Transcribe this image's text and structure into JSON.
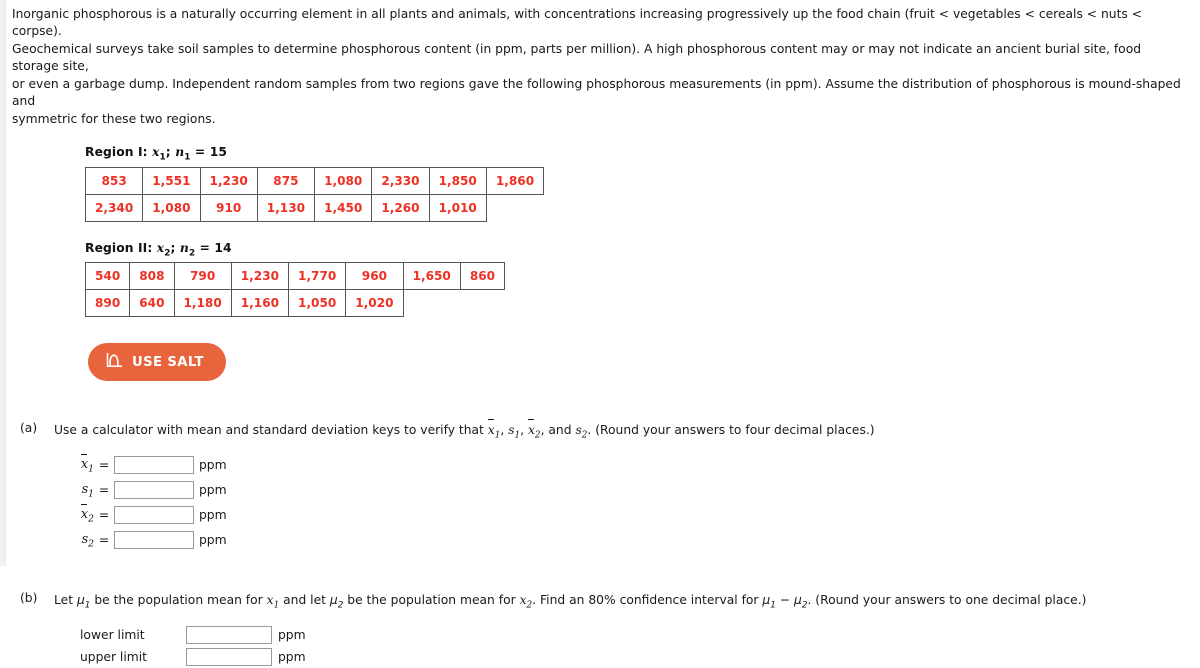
{
  "intro": {
    "line1": "Inorganic phosphorous is a naturally occurring element in all plants and animals, with concentrations increasing progressively up the food chain (fruit < vegetables < cereals < nuts < corpse).",
    "line2": "Geochemical surveys take soil samples to determine phosphorous content (in ppm, parts per million). A high phosphorous content may or may not indicate an ancient burial site, food storage site,",
    "line3": "or even a garbage dump. Independent random samples from two regions gave the following phosphorous measurements (in ppm). Assume the distribution of phosphorous is mound-shaped and",
    "line4": "symmetric for these two regions."
  },
  "regions": [
    {
      "title_prefix": "Region I:",
      "variable": "x",
      "var_sub": "1",
      "n_sub": "1",
      "n_value": "15",
      "rows": [
        [
          "853",
          "1,551",
          "1,230",
          "875",
          "1,080",
          "2,330",
          "1,850",
          "1,860"
        ],
        [
          "2,340",
          "1,080",
          "910",
          "1,130",
          "1,450",
          "1,260",
          "1,010"
        ]
      ]
    },
    {
      "title_prefix": "Region II:",
      "variable": "x",
      "var_sub": "2",
      "n_sub": "2",
      "n_value": "14",
      "rows": [
        [
          "540",
          "808",
          "790",
          "1,230",
          "1,770",
          "960",
          "1,650",
          "860"
        ],
        [
          "890",
          "640",
          "1,180",
          "1,160",
          "1,050",
          "1,020"
        ]
      ]
    }
  ],
  "salt_button": {
    "label": "USE SALT",
    "icon": "distribution-curve-icon",
    "background_color": "#e8643c",
    "text_color": "#ffffff"
  },
  "colors": {
    "data_red": "#ee3124",
    "table_border": "#555555",
    "input_border": "#999999"
  },
  "part_a": {
    "label": "(a)",
    "text_before": "Use a calculator with mean and standard deviation keys to verify that ",
    "text_after": ". (Round your answers to four decimal places.)",
    "sym1": "x",
    "sym1_sub": "1",
    "sym2": "s",
    "sym2_sub": "1",
    "sym3": "x",
    "sym3_sub": "2",
    "sym4": "s",
    "sym4_sub": "2",
    "sep1": ", ",
    "sep2": ", ",
    "sep3": ", and ",
    "fields": [
      {
        "symbol": "x",
        "sub": "1",
        "overline": true,
        "equals": "=",
        "value": "",
        "placeholder": "",
        "unit": "ppm"
      },
      {
        "symbol": "s",
        "sub": "1",
        "overline": false,
        "equals": "=",
        "value": "",
        "placeholder": "",
        "unit": "ppm"
      },
      {
        "symbol": "x",
        "sub": "2",
        "overline": true,
        "equals": "=",
        "value": "",
        "placeholder": "",
        "unit": "ppm"
      },
      {
        "symbol": "s",
        "sub": "2",
        "overline": false,
        "equals": "=",
        "value": "",
        "placeholder": "",
        "unit": "ppm"
      }
    ]
  },
  "part_b": {
    "label": "(b)",
    "t1": "Let ",
    "mu1": "μ",
    "mu1_sub": "1",
    "t2": " be the population mean for ",
    "x1": "x",
    "x1_sub": "1",
    "t3": " and let ",
    "mu2": "μ",
    "mu2_sub": "2",
    "t4": " be the population mean for ",
    "x2": "x",
    "x2_sub": "2",
    "t5": ". Find an 80% confidence interval for ",
    "mu1b": "μ",
    "mu1b_sub": "1",
    "minus": " − ",
    "mu2b": "μ",
    "mu2b_sub": "2",
    "t6": ". (Round your answers to one decimal place.)",
    "limits": [
      {
        "label": "lower limit",
        "value": "",
        "placeholder": "",
        "unit": "ppm"
      },
      {
        "label": "upper limit",
        "value": "",
        "placeholder": "",
        "unit": "ppm"
      }
    ]
  }
}
